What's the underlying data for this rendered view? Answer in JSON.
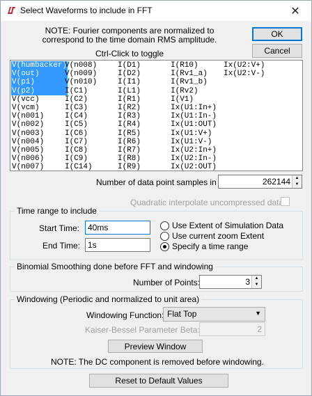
{
  "window": {
    "title": "Select Waveforms to include in FFT",
    "close_glyph": "✕"
  },
  "note": {
    "line1": "NOTE:  Fourier components are normalized to",
    "line2": "correspond to the time domain RMS amplitude."
  },
  "ctrl_hint": "Ctrl-Click to toggle",
  "buttons": {
    "ok": "OK",
    "cancel": "Cancel",
    "preview": "Preview Window",
    "reset": "Reset to Default Values"
  },
  "waveforms": {
    "col1": [
      "V(humbacker)",
      "V(out)",
      "V(p1)",
      "V(p2)",
      "V(vcc)",
      "V(vcm)",
      "V(n001)",
      "V(n002)",
      "V(n003)",
      "V(n004)",
      "V(n005)",
      "V(n006)",
      "V(n007)"
    ],
    "col2": [
      "V(n008)",
      "V(n009)",
      "V(n010)",
      "I(C1)",
      "I(C2)",
      "I(C3)",
      "I(C4)",
      "I(C5)",
      "I(C6)",
      "I(C7)",
      "I(C8)",
      "I(C9)",
      "I(C14)"
    ],
    "col3": [
      "I(D1)",
      "I(D2)",
      "I(I1)",
      "I(L1)",
      "I(R1)",
      "I(R2)",
      "I(R3)",
      "I(R4)",
      "I(R5)",
      "I(R6)",
      "I(R7)",
      "I(R8)",
      "I(R9)"
    ],
    "col4": [
      "I(R10)",
      "I(Rv1_a)",
      "I(Rv1_b)",
      "I(Rv2)",
      "I(V1)",
      "Ix(U1:In+)",
      "Ix(U1:In-)",
      "Ix(U1:OUT)",
      "Ix(U1:V+)",
      "Ix(U1:V-)",
      "Ix(U2:In+)",
      "Ix(U2:In-)",
      "Ix(U2:OUT)"
    ],
    "col5": [
      "Ix(U2:V+)",
      "Ix(U2:V-)"
    ],
    "selected": [
      "V(humbacker)",
      "V(out)",
      "V(p1)",
      "V(p2)"
    ]
  },
  "samples": {
    "label": "Number of data point samples in time:",
    "value": "262144"
  },
  "quadratic": {
    "label": "Quadratic interpolate uncompressed data",
    "checked": false
  },
  "time_range": {
    "title": "Time range to include",
    "start_label": "Start Time:",
    "start_value": "40ms",
    "end_label": "End Time:",
    "end_value": "1s",
    "options": [
      "Use Extent of Simulation Data",
      "Use current zoom Extent",
      "Specify a time range"
    ],
    "selected_option": "Specify a time range"
  },
  "smoothing": {
    "title": "Binomial Smoothing done before FFT and windowing",
    "points_label": "Number of Points:",
    "points_value": "3"
  },
  "windowing": {
    "title": "Windowing  (Periodic and normalized to unit area)",
    "function_label": "Windowing Function:",
    "function_value": "Flat Top",
    "beta_label": "Kaiser-Bessel Parameter Beta:",
    "beta_value": "2",
    "note": "NOTE:  The DC component is removed before windowing."
  }
}
